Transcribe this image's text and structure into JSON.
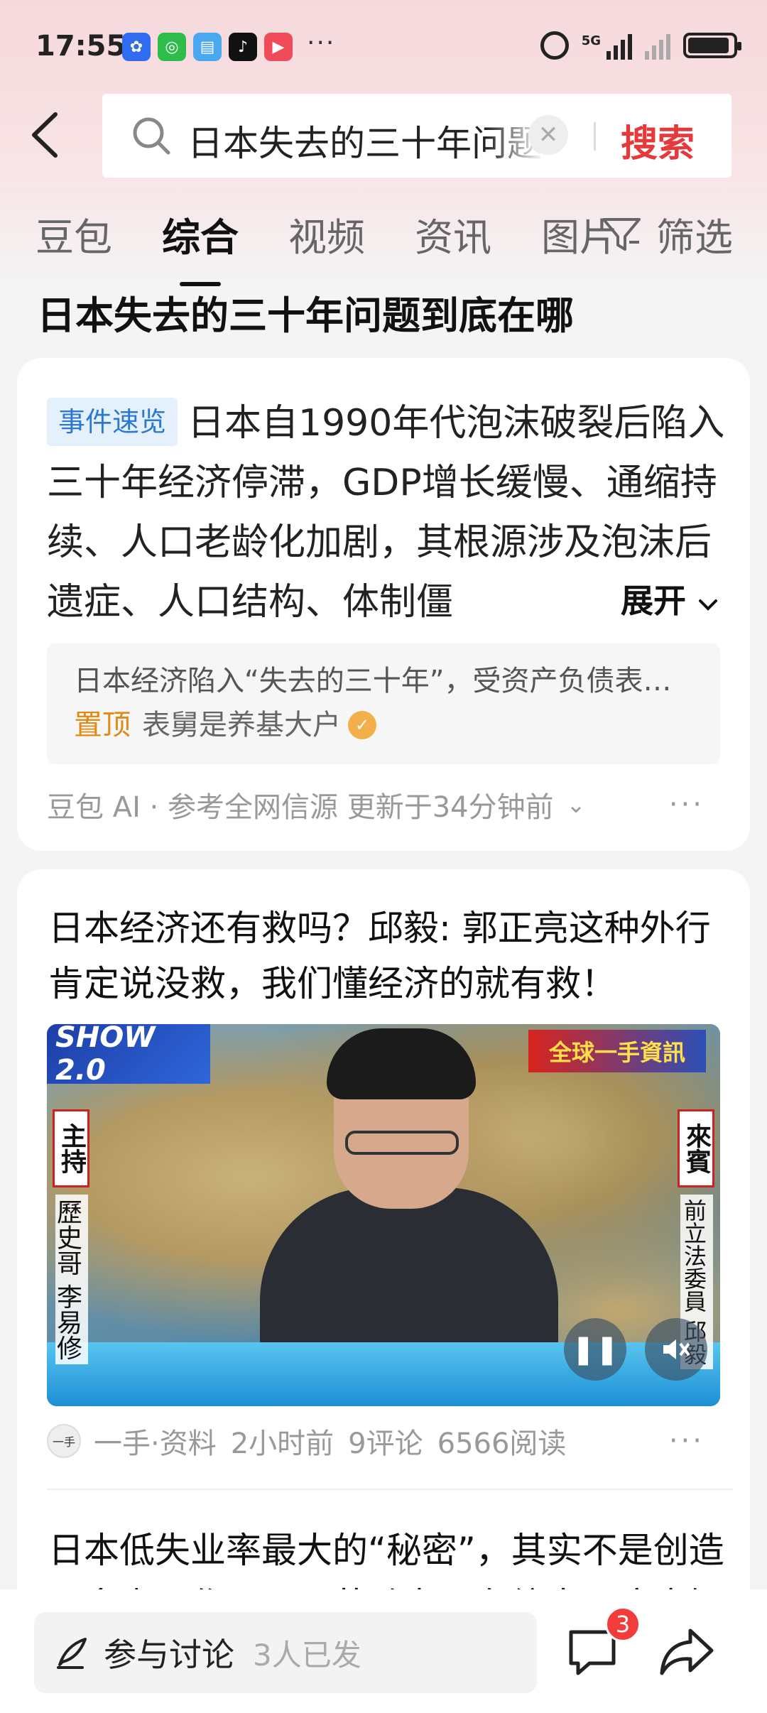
{
  "status_bar": {
    "time": "17:55",
    "network": "5G",
    "app_icons": [
      "tencent-app-icon",
      "wechat-icon",
      "book-icon",
      "tiktok-icon",
      "video-app-icon"
    ],
    "more": "···"
  },
  "search": {
    "query": "日本失去的三十年问题到底在哪",
    "button_label": "搜索"
  },
  "tabs": [
    {
      "label": "豆包",
      "active": false
    },
    {
      "label": "综合",
      "active": true
    },
    {
      "label": "视频",
      "active": false
    },
    {
      "label": "资讯",
      "active": false
    },
    {
      "label": "图片",
      "active": false
    }
  ],
  "filter_label": "筛选",
  "query_title": "日本失去的三十年问题到底在哪",
  "ai_card": {
    "badge": "事件速览",
    "summary": "日本自1990年代泡沫破裂后陷入三十年经济停滞，GDP增长缓慢、通缩持续、人口老龄化加剧，其根源涉及泡沫后遗症、人口结构、体制僵",
    "expand_label": "展开",
    "source_snippet": "日本经济陷入“失去的三十年”，受资产负债表…",
    "pinned_label": "置顶",
    "pinned_author": "表舅是养基大户",
    "footer": "豆包 AI · 参考全网信源 更新于34分钟前",
    "more": "···"
  },
  "news_card": {
    "title": "日本经济还有救吗？邱毅: 郭正亮这种外行肯定说没救，我们懂经济的就有救！",
    "video": {
      "logo_text": "SHOW 2.0",
      "top_right_text": "全球一手資訊",
      "left_tag": "主持",
      "left_name": "歷史哥 李易修",
      "right_tag": "來賓",
      "right_name": "前立法委員 邱毅"
    },
    "source": "一手·资料",
    "avatar_text": "一手",
    "time": "2小时前",
    "comments": "9评论",
    "reads": "6566阅读",
    "more": "···"
  },
  "news_card_2": {
    "title": "日本低失业率最大的“秘密”，其实不是创造了多少工作，而是劳动力正在缩水，这也解"
  },
  "bottom_bar": {
    "discuss_label": "参与讨论",
    "discuss_count": "3人已发",
    "comment_badge": "3"
  },
  "colors": {
    "accent_red": "#e63a3a",
    "badge_blue": "#2d79d0",
    "pin_orange": "#e08a14"
  }
}
